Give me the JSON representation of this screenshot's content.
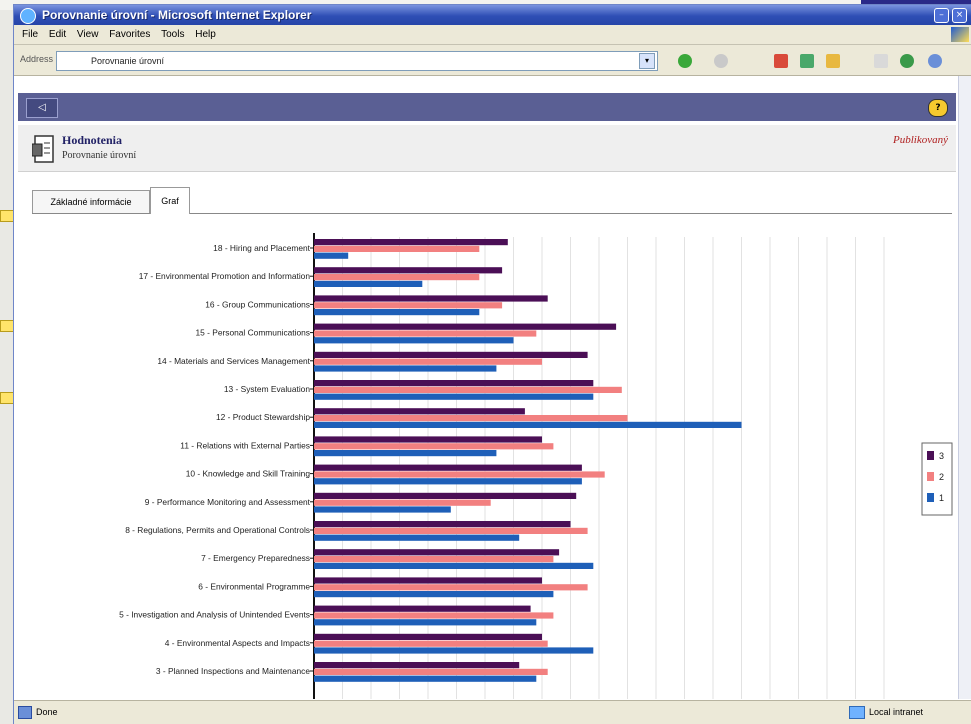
{
  "window": {
    "title": "Porovnanie úrovní - Microsoft Internet Explorer"
  },
  "menu": [
    "File",
    "Edit",
    "View",
    "Favorites",
    "Tools",
    "Help"
  ],
  "address": {
    "label": "Address",
    "value": "Porovnanie úrovní"
  },
  "page": {
    "header_title": "Hodnotenia",
    "header_subtitle": "Porovnanie úrovní",
    "status": "Publikovaný"
  },
  "tabs": [
    {
      "label": "Základné informácie",
      "active": false
    },
    {
      "label": "Graf",
      "active": true
    }
  ],
  "statusbar": {
    "left": "Done",
    "right": "Local intranet"
  },
  "colors": {
    "series3": "#4b0f56",
    "series2": "#f28080",
    "series1": "#1e5fb8"
  },
  "chart_data": {
    "type": "bar",
    "orientation": "horizontal",
    "grid": true,
    "legend": "right",
    "xlim": [
      0,
      10
    ],
    "categories": [
      "18 - Hiring and Placement",
      "17 - Environmental Promotion and Information",
      "16 - Group Communications",
      "15 - Personal Communications",
      "14 - Materials and Services Management",
      "13 - System Evaluation",
      "12 - Product Stewardship",
      "11 - Relations with External Parties",
      "10 - Knowledge and Skill Training",
      "9 - Performance Monitoring and Assessment",
      "8 - Regulations, Permits and Operational Controls",
      "7 - Emergency Preparedness",
      "6 - Environmental Programme",
      "5 - Investigation and Analysis of Unintended Events",
      "4 - Environmental Aspects and Impacts",
      "3 - Planned Inspections and Maintenance"
    ],
    "series": [
      {
        "name": "3",
        "values": [
          3.4,
          3.3,
          4.1,
          5.3,
          4.8,
          4.9,
          3.7,
          4.0,
          4.7,
          4.6,
          4.5,
          4.3,
          4.0,
          3.8,
          4.0,
          3.6
        ]
      },
      {
        "name": "2",
        "values": [
          2.9,
          2.9,
          3.3,
          3.9,
          4.0,
          5.4,
          5.5,
          4.2,
          5.1,
          3.1,
          4.8,
          4.2,
          4.8,
          4.2,
          4.1,
          4.1
        ]
      },
      {
        "name": "1",
        "values": [
          0.6,
          1.9,
          2.9,
          3.5,
          3.2,
          4.9,
          7.5,
          3.2,
          4.7,
          2.4,
          3.6,
          4.9,
          4.2,
          3.9,
          4.9,
          3.9
        ]
      }
    ]
  }
}
